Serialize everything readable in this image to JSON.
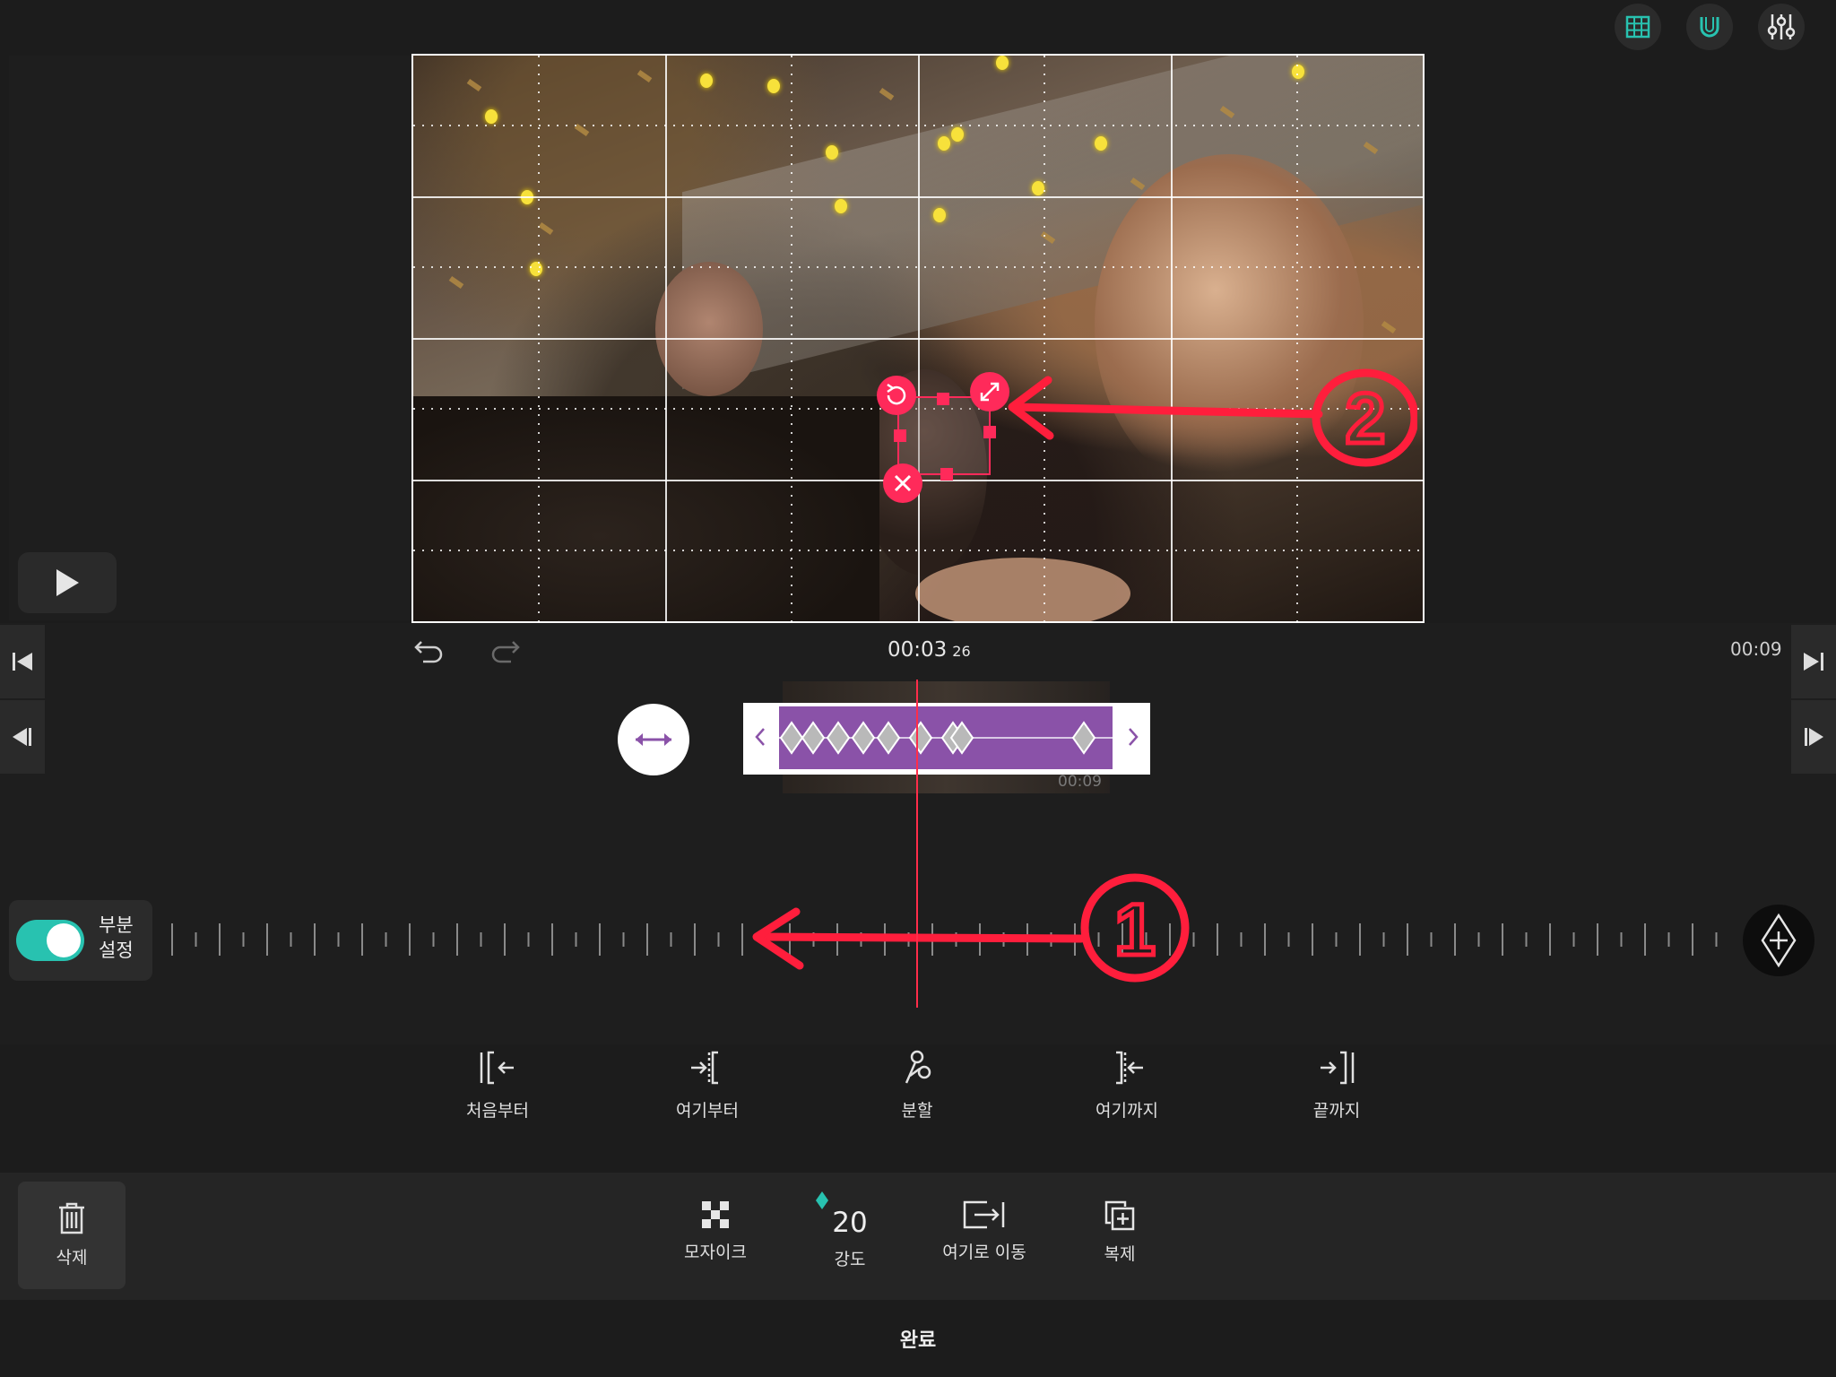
{
  "toolbar": {
    "icons": [
      "grid-icon",
      "magnet-icon",
      "sliders-icon"
    ],
    "accent_color": "#28c2b0"
  },
  "playback": {
    "current_time": "00:03",
    "current_frames": "26",
    "total_time": "00:09"
  },
  "clip": {
    "duration_label": "00:09",
    "color": "#8a52a8",
    "keyframe_count": 9
  },
  "partial_toggle": {
    "label_line1": "부분",
    "label_line2": "설정",
    "enabled": true
  },
  "edit_tools": [
    {
      "icon": "trim-from-start-icon",
      "label": "처음부터"
    },
    {
      "icon": "trim-from-here-icon",
      "label": "여기부터"
    },
    {
      "icon": "split-icon",
      "label": "분할"
    },
    {
      "icon": "trim-to-here-icon",
      "label": "여기까지"
    },
    {
      "icon": "trim-to-end-icon",
      "label": "끝까지"
    }
  ],
  "bottom_tools": {
    "delete_label": "삭제",
    "mosaic_label": "모자이크",
    "strength_value": "20",
    "strength_label": "강도",
    "move_here_label": "여기로 이동",
    "duplicate_label": "복제"
  },
  "done_label": "완료",
  "annotations": {
    "marker_1": "1",
    "marker_2": "2",
    "color": "#ff1e3c"
  }
}
